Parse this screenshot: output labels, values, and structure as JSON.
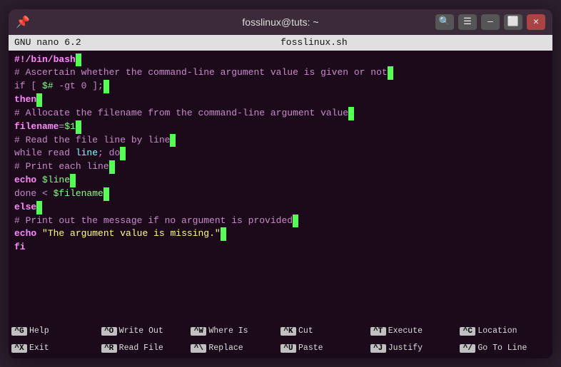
{
  "titlebar": {
    "title": "fosslinux@tuts: ~",
    "buttons": [
      "search",
      "menu",
      "minimize",
      "maximize",
      "close"
    ]
  },
  "nano_header": {
    "left": "GNU nano 6.2",
    "center": "fosslinux.sh",
    "right": ""
  },
  "editor": {
    "lines": [
      {
        "type": "shebang",
        "content": "#!/bin/bash"
      },
      {
        "type": "comment",
        "content": "# Ascertain whether the command-line argument value is given or not"
      },
      {
        "type": "code",
        "content": "if [ $# -gt 0 ];"
      },
      {
        "type": "keyword",
        "content": "then"
      },
      {
        "type": "comment",
        "content": "# Allocate the filename from the command-line argument value"
      },
      {
        "type": "code",
        "content": "filename=$1"
      },
      {
        "type": "comment",
        "content": "# Read the file line by line"
      },
      {
        "type": "code",
        "content": "while read line; do"
      },
      {
        "type": "comment",
        "content": "# Print each line"
      },
      {
        "type": "code",
        "content": "echo $line"
      },
      {
        "type": "code",
        "content": "done < $filename"
      },
      {
        "type": "keyword",
        "content": "else"
      },
      {
        "type": "comment",
        "content": "# Print out the message if no argument is provided"
      },
      {
        "type": "code",
        "content": "echo \"The argument value is missing.\""
      },
      {
        "type": "keyword",
        "content": "fi"
      }
    ]
  },
  "shortcuts": {
    "row1": [
      {
        "key": "^G",
        "label": "Help"
      },
      {
        "key": "^O",
        "label": "Write Out"
      },
      {
        "key": "^W",
        "label": "Where Is"
      },
      {
        "key": "^K",
        "label": "Cut"
      },
      {
        "key": "^T",
        "label": "Execute"
      },
      {
        "key": "^C",
        "label": "Location"
      }
    ],
    "row2": [
      {
        "key": "^X",
        "label": "Exit"
      },
      {
        "key": "^R",
        "label": "Read File"
      },
      {
        "key": "^\\",
        "label": "Replace"
      },
      {
        "key": "^U",
        "label": "Paste"
      },
      {
        "key": "^J",
        "label": "Justify"
      },
      {
        "key": "^/",
        "label": "Go To Line"
      }
    ]
  }
}
